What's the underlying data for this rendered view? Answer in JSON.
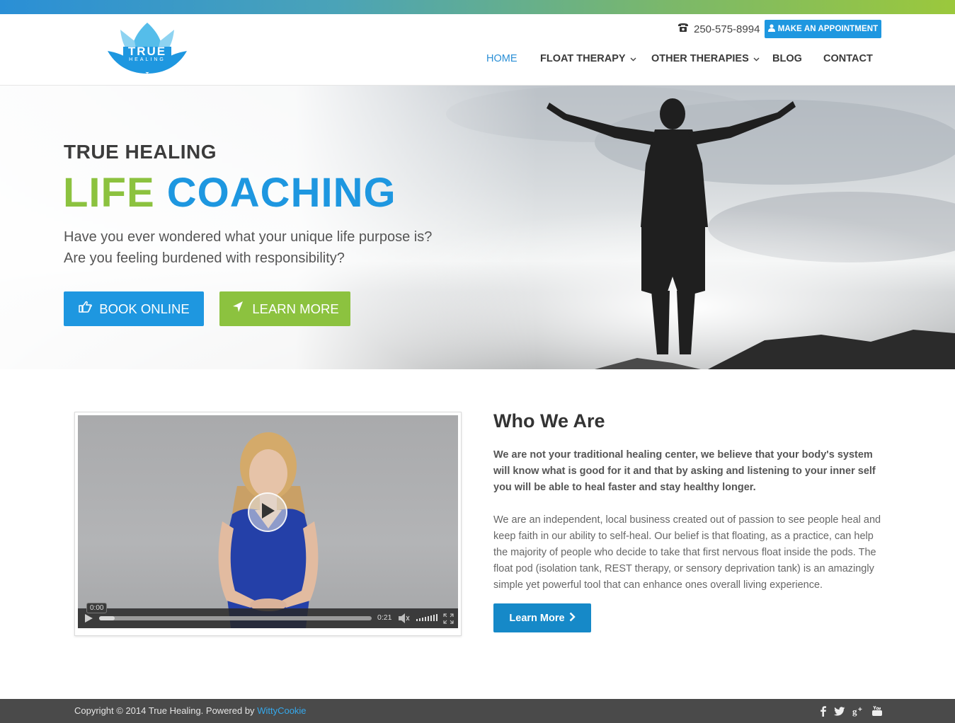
{
  "brand": {
    "logo_text": "TRUE",
    "logo_subtext": "HEALING",
    "colors": {
      "blue": "#1e97e0",
      "green": "#8cc23f",
      "footer": "#4a4a4a"
    }
  },
  "header": {
    "phone": "250-575-8994",
    "phone_icon": "phone-icon",
    "appointment_label": "MAKE AN APPOINTMENT",
    "appointment_icon": "user-icon",
    "nav": [
      {
        "label": "HOME",
        "active": true
      },
      {
        "label": "FLOAT THERAPY",
        "dropdown": true
      },
      {
        "label": "OTHER THERAPIES",
        "dropdown": true
      },
      {
        "label": "BLOG"
      },
      {
        "label": "CONTACT"
      }
    ]
  },
  "hero": {
    "kicker": "TRUE HEALING",
    "title_part1": "LIFE",
    "title_part2": "COACHING",
    "sub_line1": "Have you ever wondered what your unique life purpose is?",
    "sub_line2": "Are you feeling burdened with responsibility?",
    "book_label": "BOOK ONLINE",
    "book_icon": "hand-pointing-icon",
    "learn_label": "LEARN MORE",
    "learn_icon": "location-arrow-icon"
  },
  "video": {
    "current_time": "0:00",
    "duration": "0:21",
    "progress": 0.0
  },
  "about": {
    "title_light": "Who",
    "title_bold": "We Are",
    "lead": "We are not your traditional healing center, we believe that your body's system will know what is good for it and that by asking and listening to your inner self you will be able to heal faster and stay healthy longer.",
    "body": "We are an independent, local business created out of passion to see people heal and keep faith in our ability to self-heal. Our belief is that floating, as a practice, can help the majority of people who decide to take that first nervous float inside the pods. The float pod (isolation tank, REST therapy, or sensory deprivation tank) is an amazingly simple yet powerful tool that can enhance ones overall living experience.",
    "button_label": "Learn More"
  },
  "footer": {
    "copyright": "Copyright © 2014 True Healing. Powered by",
    "powered_by": "WittyCookie",
    "social": [
      "facebook-icon",
      "twitter-icon",
      "google-plus-icon",
      "youtube-icon"
    ]
  }
}
